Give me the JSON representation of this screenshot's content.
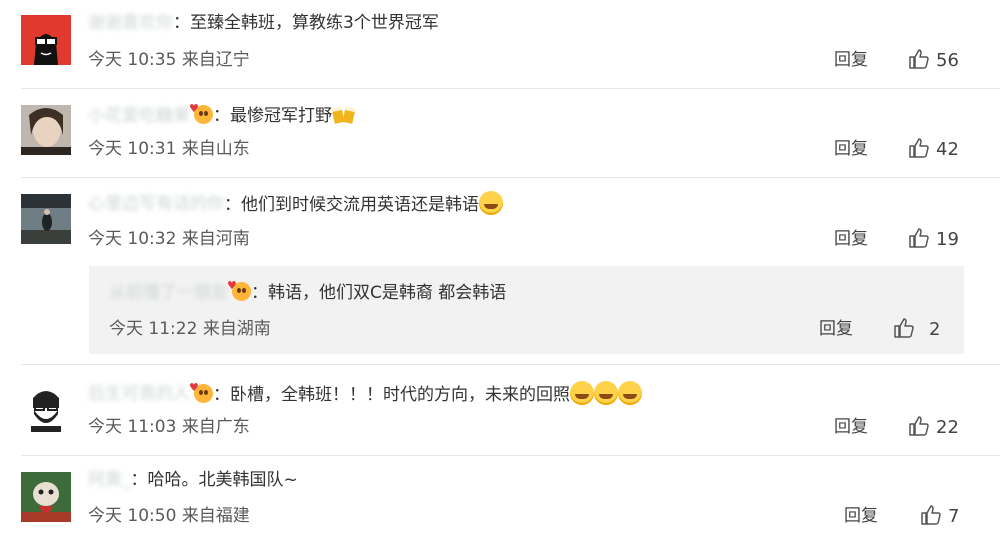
{
  "colors": {
    "text": "#333333",
    "meta": "#5a5a5a",
    "subbox_bg": "#f2f2f2",
    "divider": "#e6e6e6",
    "badge": "#ffb43a"
  },
  "comments": [
    {
      "username": "谢谢喜欢你",
      "text": "至臻全韩班，算教练3个世界冠军",
      "time": "今天 10:35",
      "location": "来自辽宁",
      "reply_label": "回复",
      "likes": "56",
      "has_badge": false
    },
    {
      "username": "小花爱吃糖果",
      "text": "最惨冠军打野",
      "time": "今天 10:31",
      "location": "来自山东",
      "reply_label": "回复",
      "likes": "42",
      "has_badge": true
    },
    {
      "username": "心里边写有话的你",
      "text": "他们到时候交流用英语还是韩语",
      "time": "今天 10:32",
      "location": "来自河南",
      "reply_label": "回复",
      "likes": "19",
      "has_badge": false
    },
    {
      "username": "从前慢了一朋友",
      "text": "韩语，他们双C是韩裔 都会韩语",
      "time": "今天 11:22",
      "location": "来自湖南",
      "reply_label": "回复",
      "likes": "2",
      "has_badge": true
    },
    {
      "username": "后生可畏的人",
      "text": "卧槽，全韩班！！！时代的方向，未来的回照",
      "time": "今天 11:03",
      "location": "来自广东",
      "reply_label": "回复",
      "likes": "22",
      "has_badge": true
    },
    {
      "username": "阿黄_",
      "text": "哈哈。北美韩国队~",
      "time": "今天 10:50",
      "location": "来自福建",
      "reply_label": "回复",
      "likes": "7",
      "has_badge": false
    }
  ],
  "sep": "："
}
